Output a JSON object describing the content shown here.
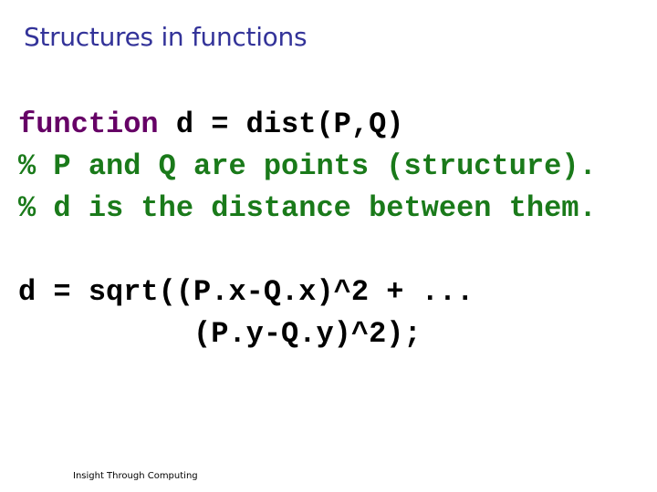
{
  "title": "Structures in functions",
  "code": {
    "line1_keyword": "function",
    "line1_rest": " d = dist(P,Q)",
    "line2_comment": "% P and Q are points (structure).",
    "line3_comment": "% d is the distance between them.",
    "line4": "d = sqrt((P.x-Q.x)^2 + ...",
    "line5": "          (P.y-Q.y)^2);"
  },
  "footer": "Insight Through Computing",
  "colors": {
    "title": "#333399",
    "keyword": "#660066",
    "comment": "#1a7a1a",
    "code": "#000000"
  }
}
